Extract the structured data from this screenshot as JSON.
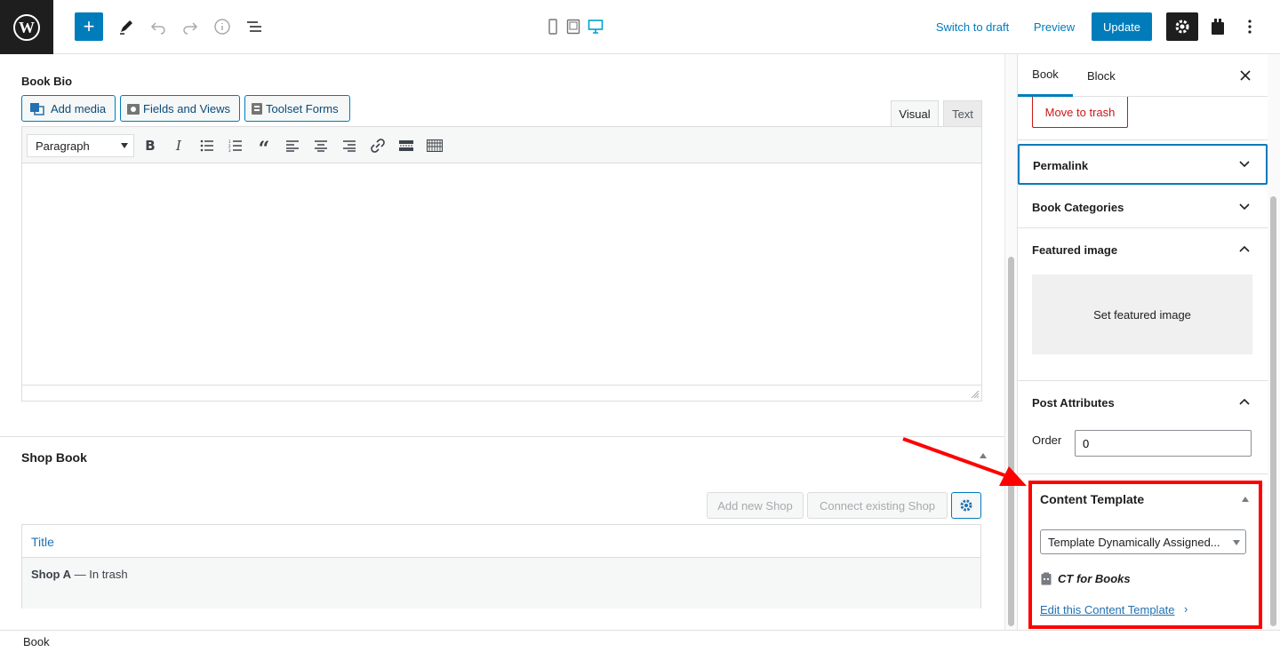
{
  "topbar": {
    "switch_to_draft": "Switch to draft",
    "preview": "Preview",
    "update": "Update",
    "icons": [
      "wordpress-logo",
      "plus-icon",
      "pen-icon",
      "undo-icon",
      "redo-icon",
      "info-icon",
      "list-view-icon",
      "mobile-icon",
      "tablet-icon",
      "desktop-icon",
      "gear-icon",
      "plugin-icon",
      "more-icon"
    ]
  },
  "book_bio": {
    "heading": "Book Bio",
    "buttons": {
      "add_media": "Add media",
      "fields_views": "Fields and Views",
      "toolset_forms": "Toolset Forms"
    },
    "tabs": {
      "visual": "Visual",
      "text": "Text"
    },
    "format_select": "Paragraph"
  },
  "shop_book": {
    "heading": "Shop Book",
    "add_new": "Add new Shop",
    "connect_existing": "Connect existing Shop",
    "table": {
      "header": "Title",
      "row_title": "Shop A",
      "row_suffix": " — In trash"
    }
  },
  "sidebar": {
    "tabs": {
      "book": "Book",
      "block": "Block"
    },
    "move_to_trash": "Move to trash",
    "permalink": "Permalink",
    "book_categories": "Book Categories",
    "featured_image": "Featured image",
    "set_featured_image": "Set featured image",
    "post_attributes": "Post Attributes",
    "order_label": "Order",
    "order_value": "0",
    "content_template": {
      "title": "Content Template",
      "select_value": "Template Dynamically Assigned...",
      "template_name": "CT for Books",
      "edit_link": "Edit this Content Template"
    }
  },
  "footer": {
    "breadcrumb": "Book"
  },
  "colors": {
    "accent": "#007cba",
    "highlight": "#ff0000",
    "dark": "#1e1e1e",
    "trash": "#cc1818"
  }
}
